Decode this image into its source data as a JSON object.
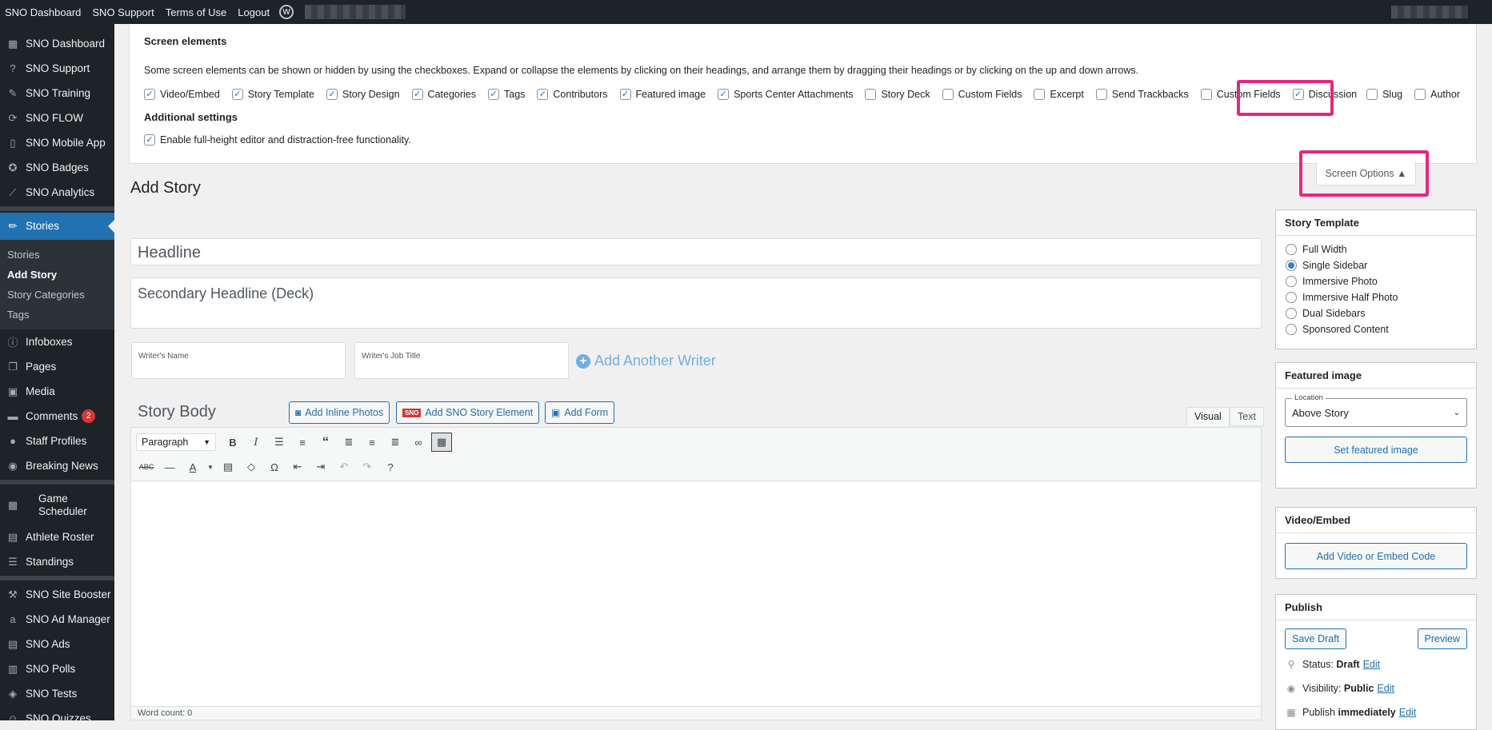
{
  "adminbar": {
    "links": [
      "SNO Dashboard",
      "SNO Support",
      "Terms of Use",
      "Logout"
    ],
    "wp_logo": "wordpress-icon"
  },
  "sidebar": {
    "top_items": [
      {
        "label": "SNO Dashboard",
        "icon": "dashboard-icon",
        "glyph": "▦"
      },
      {
        "label": "SNO Support",
        "icon": "help-icon",
        "glyph": "?"
      },
      {
        "label": "SNO Training",
        "icon": "graduation-cap-icon",
        "glyph": "✎"
      },
      {
        "label": "SNO FLOW",
        "icon": "flow-icon",
        "glyph": "⟳"
      },
      {
        "label": "SNO Mobile App",
        "icon": "mobile-icon",
        "glyph": "▯"
      },
      {
        "label": "SNO Badges",
        "icon": "award-icon",
        "glyph": "✪"
      },
      {
        "label": "SNO Analytics",
        "icon": "chart-icon",
        "glyph": "⟋"
      }
    ],
    "current": {
      "label": "Stories",
      "icon": "pin-icon",
      "glyph": "✏"
    },
    "submenu": [
      "Stories",
      "Add Story",
      "Story Categories",
      "Tags"
    ],
    "submenu_active": "Add Story",
    "middle_items": [
      {
        "label": "Infoboxes",
        "icon": "info-icon",
        "glyph": "ⓘ"
      },
      {
        "label": "Pages",
        "icon": "pages-icon",
        "glyph": "❐"
      },
      {
        "label": "Media",
        "icon": "media-icon",
        "glyph": "▣"
      },
      {
        "label": "Comments",
        "icon": "comments-icon",
        "glyph": "▬",
        "badge": "2"
      },
      {
        "label": "Staff Profiles",
        "icon": "user-icon",
        "glyph": "●"
      },
      {
        "label": "Breaking News",
        "icon": "megaphone-icon",
        "glyph": "◉"
      }
    ],
    "sports_items": [
      {
        "label": "Game Scheduler",
        "icon": "calendar-icon",
        "glyph": "▦"
      },
      {
        "label": "Athlete Roster",
        "icon": "id-card-icon",
        "glyph": "▤"
      },
      {
        "label": "Standings",
        "icon": "list-icon",
        "glyph": "☰"
      }
    ],
    "bottom_items": [
      {
        "label": "SNO Site Booster",
        "icon": "hammer-icon",
        "glyph": "⚒"
      },
      {
        "label": "SNO Ad Manager",
        "icon": "ad-manager-icon",
        "glyph": "a"
      },
      {
        "label": "SNO Ads",
        "icon": "ads-icon",
        "glyph": "▤"
      },
      {
        "label": "SNO Polls",
        "icon": "polls-icon",
        "glyph": "▥"
      },
      {
        "label": "SNO Tests",
        "icon": "tests-icon",
        "glyph": "◈"
      },
      {
        "label": "SNO Quizzes",
        "icon": "quizzes-icon",
        "glyph": "☺"
      }
    ]
  },
  "screen_options": {
    "heading": "Screen elements",
    "description": "Some screen elements can be shown or hidden by using the checkboxes. Expand or collapse the elements by clicking on their headings, and arrange them by dragging their headings or by clicking on the up and down arrows.",
    "checkboxes": [
      {
        "label": "Video/Embed",
        "checked": true
      },
      {
        "label": "Story Template",
        "checked": true
      },
      {
        "label": "Story Design",
        "checked": true
      },
      {
        "label": "Categories",
        "checked": true
      },
      {
        "label": "Tags",
        "checked": true
      },
      {
        "label": "Contributors",
        "checked": true
      },
      {
        "label": "Featured image",
        "checked": true
      },
      {
        "label": "Sports Center Attachments",
        "checked": true
      },
      {
        "label": "Story Deck",
        "checked": false
      },
      {
        "label": "Custom Fields",
        "checked": false
      },
      {
        "label": "Excerpt",
        "checked": false
      },
      {
        "label": "Send Trackbacks",
        "checked": false
      },
      {
        "label": "Custom Fields",
        "checked": false
      },
      {
        "label": "Discussion",
        "checked": true
      },
      {
        "label": "Slug",
        "checked": false
      },
      {
        "label": "Author",
        "checked": false
      }
    ],
    "additional_heading": "Additional settings",
    "additional_checkbox": {
      "label": "Enable full-height editor and distraction-free functionality.",
      "checked": true
    },
    "toggle_button": "Screen Options ▲"
  },
  "main": {
    "title": "Add Story",
    "headline_placeholder": "Headline",
    "deck_placeholder": "Secondary Headline (Deck)",
    "writer_name_label": "Writer's Name",
    "writer_title_label": "Writer's Job Title",
    "add_writer": "Add Another Writer",
    "story_body_label": "Story Body",
    "buttons": {
      "inline_photos": "Add Inline Photos",
      "sno_element": "Add SNO Story Element",
      "add_form": "Add Form",
      "sno_logo_text": "SNO"
    },
    "tabs": {
      "visual": "Visual",
      "text": "Text"
    },
    "format_select": "Paragraph",
    "word_count": "Word count: 0"
  },
  "story_template": {
    "title": "Story Template",
    "options": [
      "Full Width",
      "Single Sidebar",
      "Immersive Photo",
      "Immersive Half Photo",
      "Dual Sidebars",
      "Sponsored Content"
    ],
    "selected": "Single Sidebar"
  },
  "featured_image": {
    "title": "Featured image",
    "location_label": "Location",
    "location_value": "Above Story",
    "button": "Set featured image"
  },
  "video_embed": {
    "title": "Video/Embed",
    "button": "Add Video or Embed Code"
  },
  "publish": {
    "title": "Publish",
    "save_draft": "Save Draft",
    "preview": "Preview",
    "status_label": "Status:",
    "status_value": "Draft",
    "visibility_label": "Visibility:",
    "visibility_value": "Public",
    "publish_label": "Publish",
    "publish_value": "immediately",
    "edit": "Edit"
  },
  "colors": {
    "highlight": "#e4287c",
    "accent": "#2271b1",
    "sidebar_bg": "#1d2327"
  }
}
